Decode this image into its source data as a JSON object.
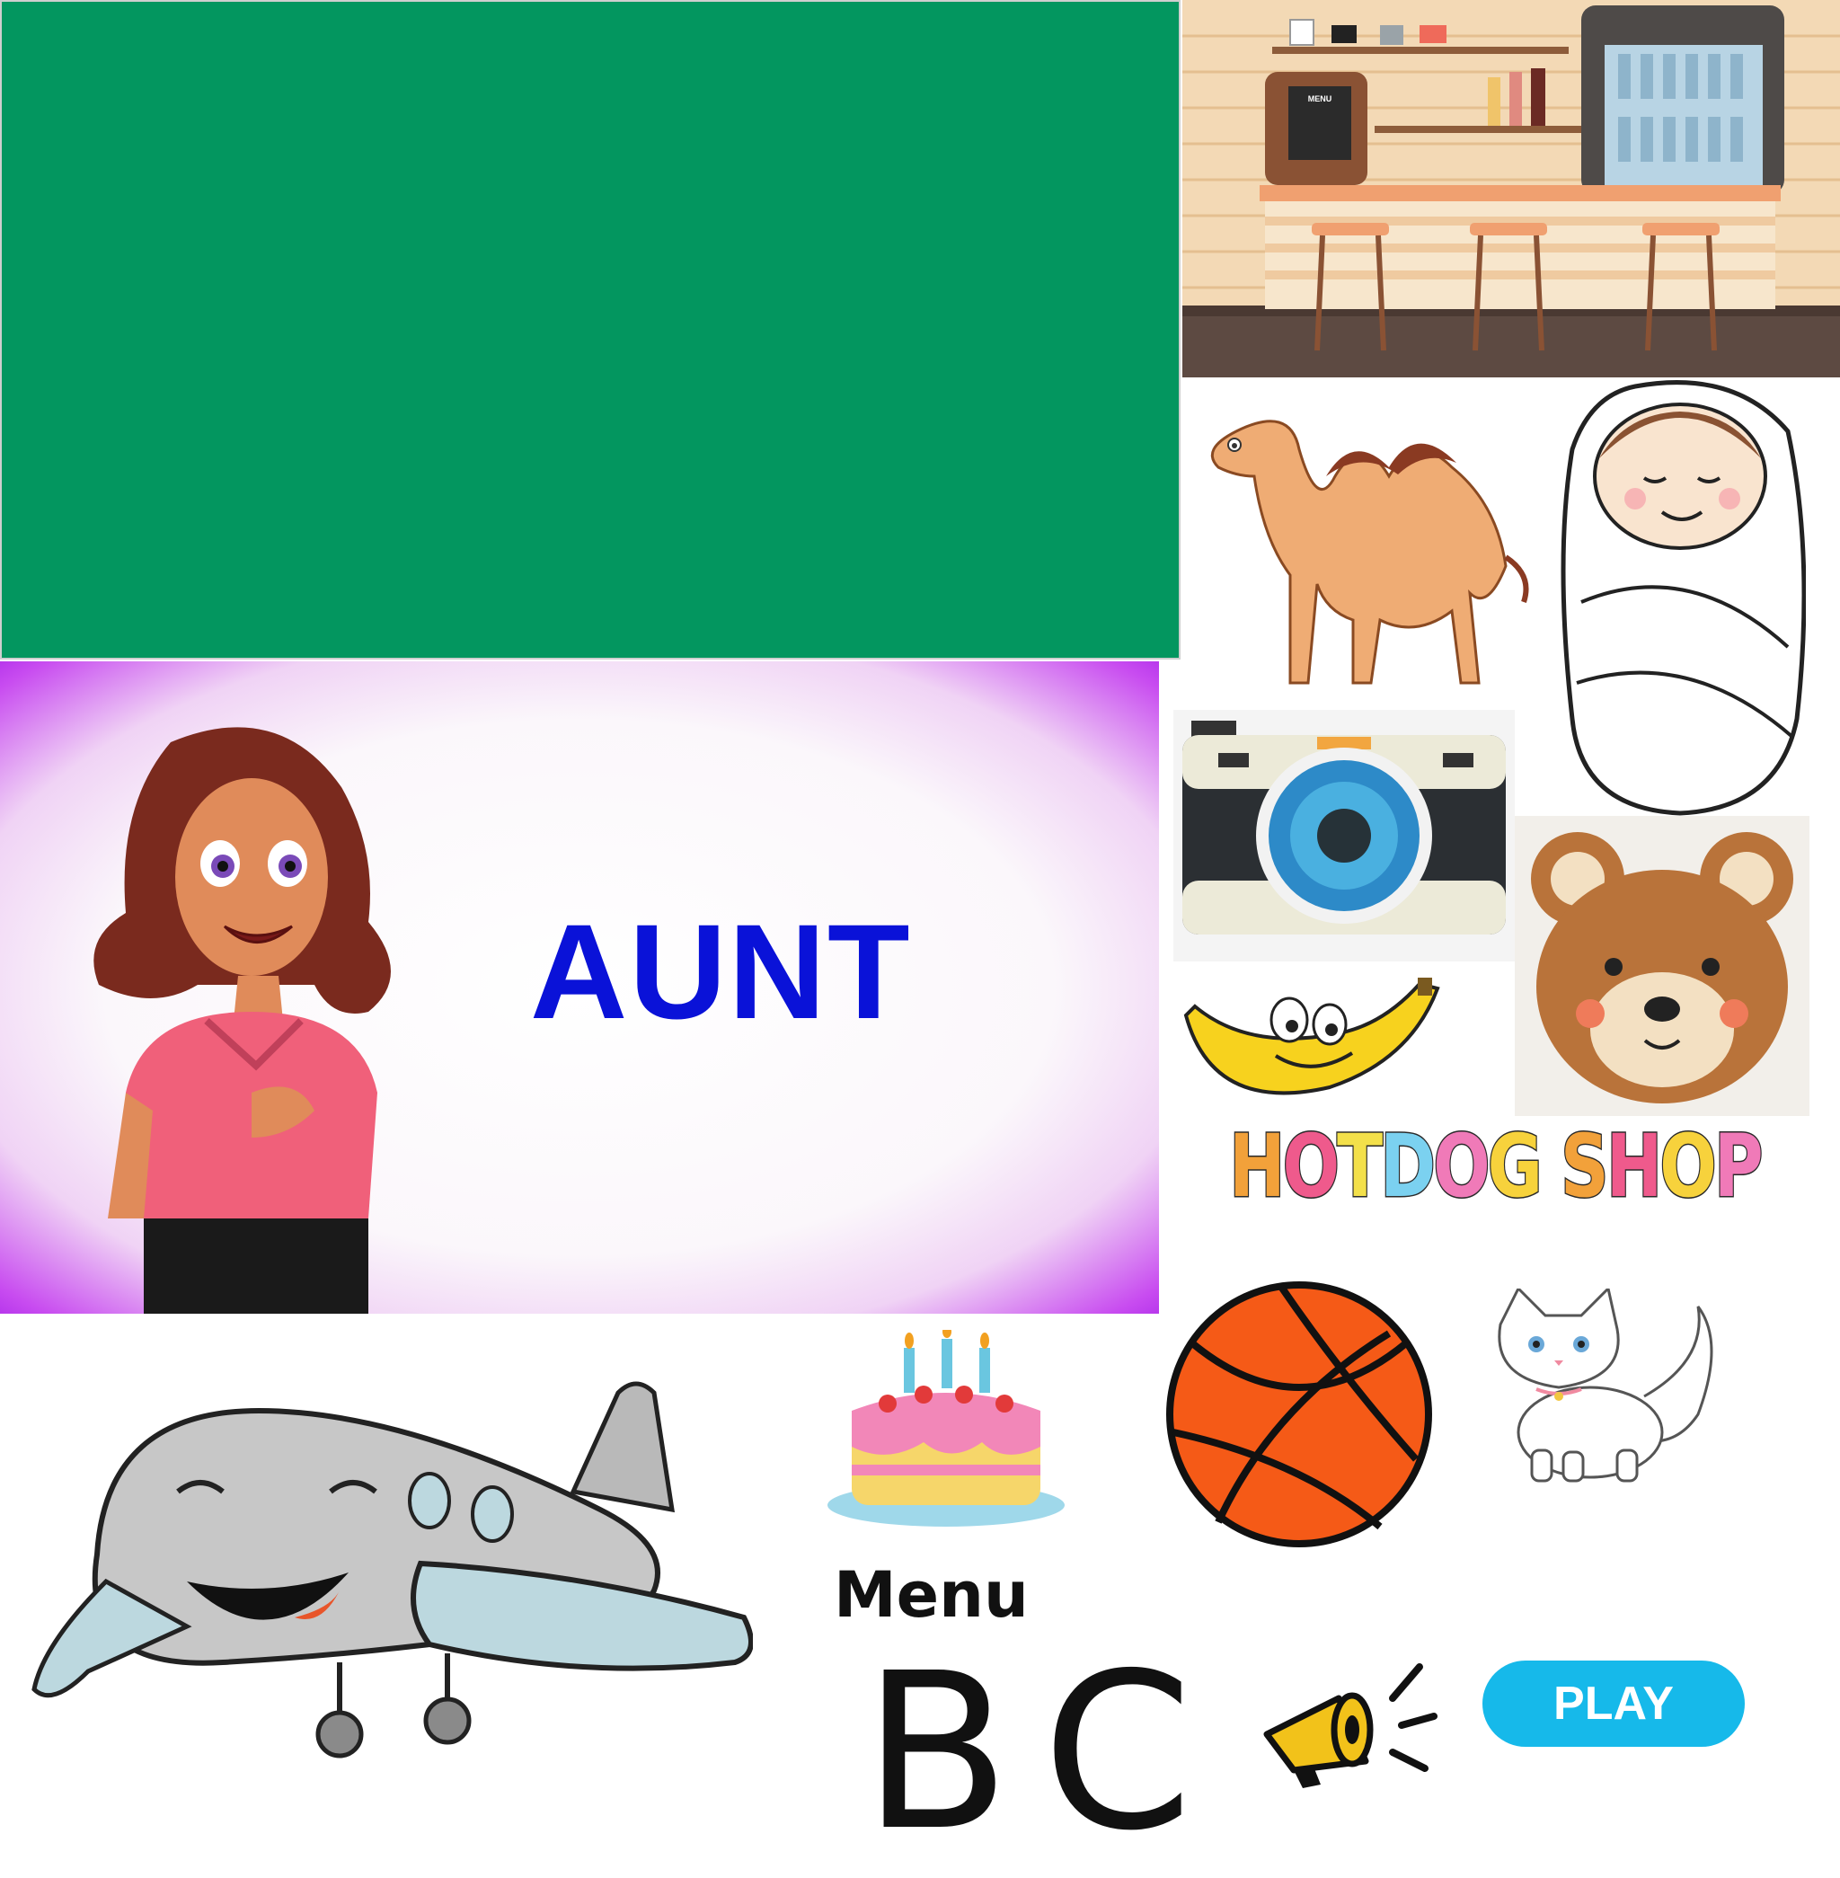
{
  "aunt_card": {
    "word": "AUNT",
    "word_color": "#0a12d8"
  },
  "hotdog_shop": {
    "title_parts": [
      "H",
      "O",
      "T",
      "D",
      "O",
      "G",
      " ",
      "S",
      "H",
      "O",
      "P"
    ],
    "colors": [
      "#f2a13a",
      "#ef5a8c",
      "#f3e04a",
      "#7bd1f0",
      "#f07ab8",
      "#f7d23c",
      "#ffffff",
      "#f2a13a",
      "#ef5a8c",
      "#f7d23c",
      "#f07ab8"
    ]
  },
  "cafe": {
    "menu_board_text": "MENU"
  },
  "menu": {
    "label": "Menu"
  },
  "letters": {
    "b": "B",
    "c": "C"
  },
  "play": {
    "label": "PLAY",
    "color": "#16b9ea"
  },
  "colors": {
    "green_panel": "#03965f",
    "basketball": "#f55a17"
  }
}
